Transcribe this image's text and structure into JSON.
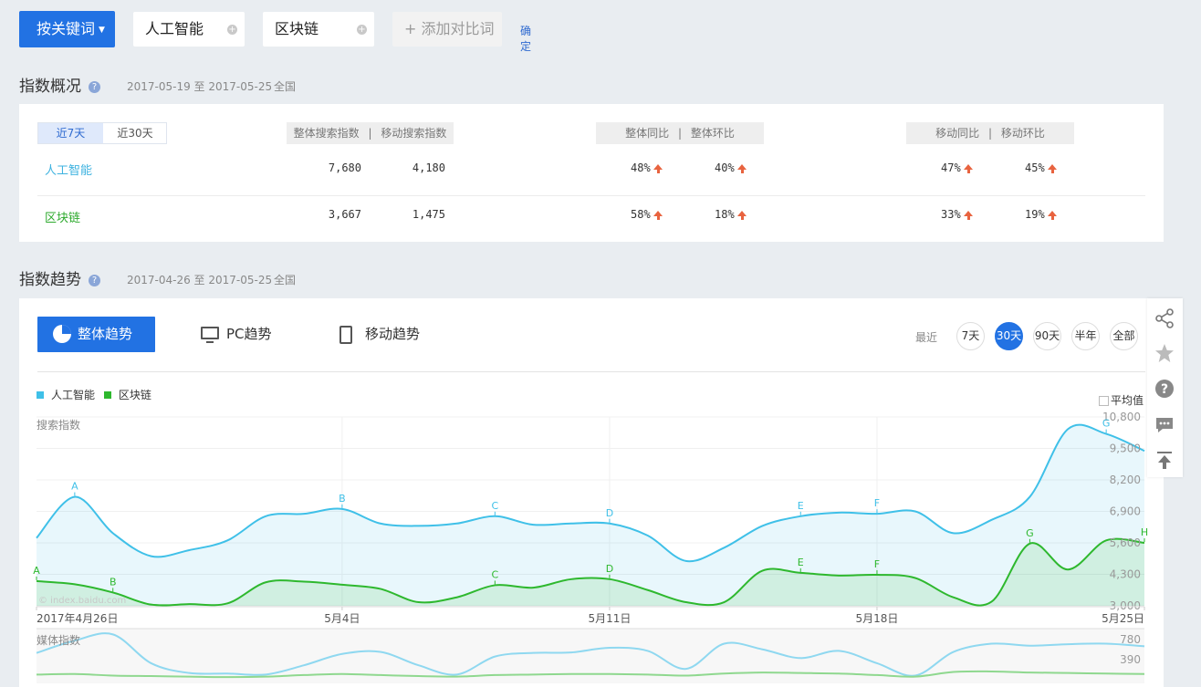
{
  "topbar": {
    "keyword_button": "按关键词",
    "keywords": [
      "人工智能",
      "区块链"
    ],
    "add_compare": "添加对比词",
    "confirm": "确定"
  },
  "overview": {
    "title": "指数概况",
    "date_range": "2017-05-19 至 2017-05-25",
    "region": "全国",
    "tabs": [
      "近7天",
      "近30天"
    ],
    "headers": {
      "search": "整体搜索指数",
      "mobile_search": "移动搜索指数",
      "yoy": "整体同比",
      "mom": "整体环比",
      "mobile_yoy": "移动同比",
      "mobile_mom": "移动环比",
      "sep": "|"
    },
    "rows": [
      {
        "name": "人工智能",
        "search": "7,680",
        "mobile": "4,180",
        "yoy": "48%",
        "mom": "40%",
        "m_yoy": "47%",
        "m_mom": "45%"
      },
      {
        "name": "区块链",
        "search": "3,667",
        "mobile": "1,475",
        "yoy": "58%",
        "mom": "18%",
        "m_yoy": "33%",
        "m_mom": "19%"
      }
    ]
  },
  "trend": {
    "title": "指数趋势",
    "date_range": "2017-04-26 至 2017-05-25",
    "region": "全国",
    "views": [
      "整体趋势",
      "PC趋势",
      "移动趋势"
    ],
    "recent_label": "最近",
    "periods": [
      "7天",
      "30天",
      "90天",
      "半年",
      "全部"
    ],
    "active_period": "30天",
    "avg_label": "平均值",
    "watermark": "© index.baidu.com"
  },
  "colors": {
    "primary": "#2272e3",
    "ai": "#3fc0e8",
    "blockchain": "#2eb82e",
    "up_arrow": "#e8633f"
  },
  "chart_data": {
    "type": "area",
    "ylabel": "搜索指数",
    "xlabels": [
      "2017年4月26日",
      "5月4日",
      "5月11日",
      "5月18日",
      "5月25日"
    ],
    "yticks": [
      "3,000",
      "4,300",
      "5,600",
      "6,900",
      "8,200",
      "9,500",
      "10,800"
    ],
    "ylim": [
      3000,
      10800
    ],
    "legend": "top-left",
    "grid": true,
    "x": [
      "4/26",
      "4/27",
      "4/28",
      "4/29",
      "4/30",
      "5/1",
      "5/2",
      "5/3",
      "5/4",
      "5/5",
      "5/6",
      "5/7",
      "5/8",
      "5/9",
      "5/10",
      "5/11",
      "5/12",
      "5/13",
      "5/14",
      "5/15",
      "5/16",
      "5/17",
      "5/18",
      "5/19",
      "5/20",
      "5/21",
      "5/22",
      "5/23",
      "5/24",
      "5/25"
    ],
    "series": [
      {
        "name": "人工智能",
        "color": "#3fc0e8",
        "values": [
          5800,
          7500,
          6000,
          5050,
          5300,
          5700,
          6700,
          6800,
          7000,
          6400,
          6300,
          6400,
          6700,
          6350,
          6400,
          6400,
          5900,
          4850,
          5400,
          6300,
          6700,
          6850,
          6800,
          6900,
          6000,
          6550,
          7500,
          10300,
          10100,
          9400
        ],
        "annotations": [
          {
            "label": "A",
            "i": 1
          },
          {
            "label": "B",
            "i": 8
          },
          {
            "label": "C",
            "i": 12
          },
          {
            "label": "D",
            "i": 15
          },
          {
            "label": "E",
            "i": 20
          },
          {
            "label": "F",
            "i": 22
          },
          {
            "label": "G",
            "i": 28
          }
        ]
      },
      {
        "name": "区块链",
        "color": "#2eb82e",
        "values": [
          4020,
          3890,
          3550,
          3050,
          3070,
          3100,
          3970,
          4000,
          3870,
          3700,
          3150,
          3350,
          3850,
          3750,
          4100,
          4100,
          3650,
          3150,
          3150,
          4450,
          4360,
          4250,
          4280,
          4150,
          3350,
          3170,
          5570,
          4500,
          5700,
          5600
        ],
        "annotations": [
          {
            "label": "A",
            "i": 0
          },
          {
            "label": "B",
            "i": 2
          },
          {
            "label": "C",
            "i": 12
          },
          {
            "label": "D",
            "i": 15
          },
          {
            "label": "E",
            "i": 20
          },
          {
            "label": "F",
            "i": 22
          },
          {
            "label": "G",
            "i": 26
          },
          {
            "label": "H",
            "i": 29
          }
        ]
      }
    ],
    "media": {
      "label": "媒体指数",
      "yticks": [
        "390",
        "780"
      ],
      "ylim": [
        0,
        780
      ],
      "series": [
        {
          "name": "人工智能",
          "color": "#8fd8f0",
          "values": [
            520,
            760,
            880,
            320,
            130,
            120,
            100,
            280,
            500,
            540,
            280,
            100,
            450,
            520,
            530,
            620,
            560,
            210,
            700,
            590,
            420,
            560,
            320,
            80,
            540,
            700,
            660,
            690,
            700,
            650
          ]
        },
        {
          "name": "区块链",
          "color": "#8fd88f",
          "values": [
            100,
            110,
            80,
            70,
            60,
            50,
            60,
            90,
            110,
            90,
            70,
            60,
            90,
            100,
            110,
            110,
            100,
            80,
            120,
            140,
            130,
            120,
            90,
            60,
            150,
            160,
            140,
            130,
            120,
            110
          ]
        }
      ]
    }
  }
}
